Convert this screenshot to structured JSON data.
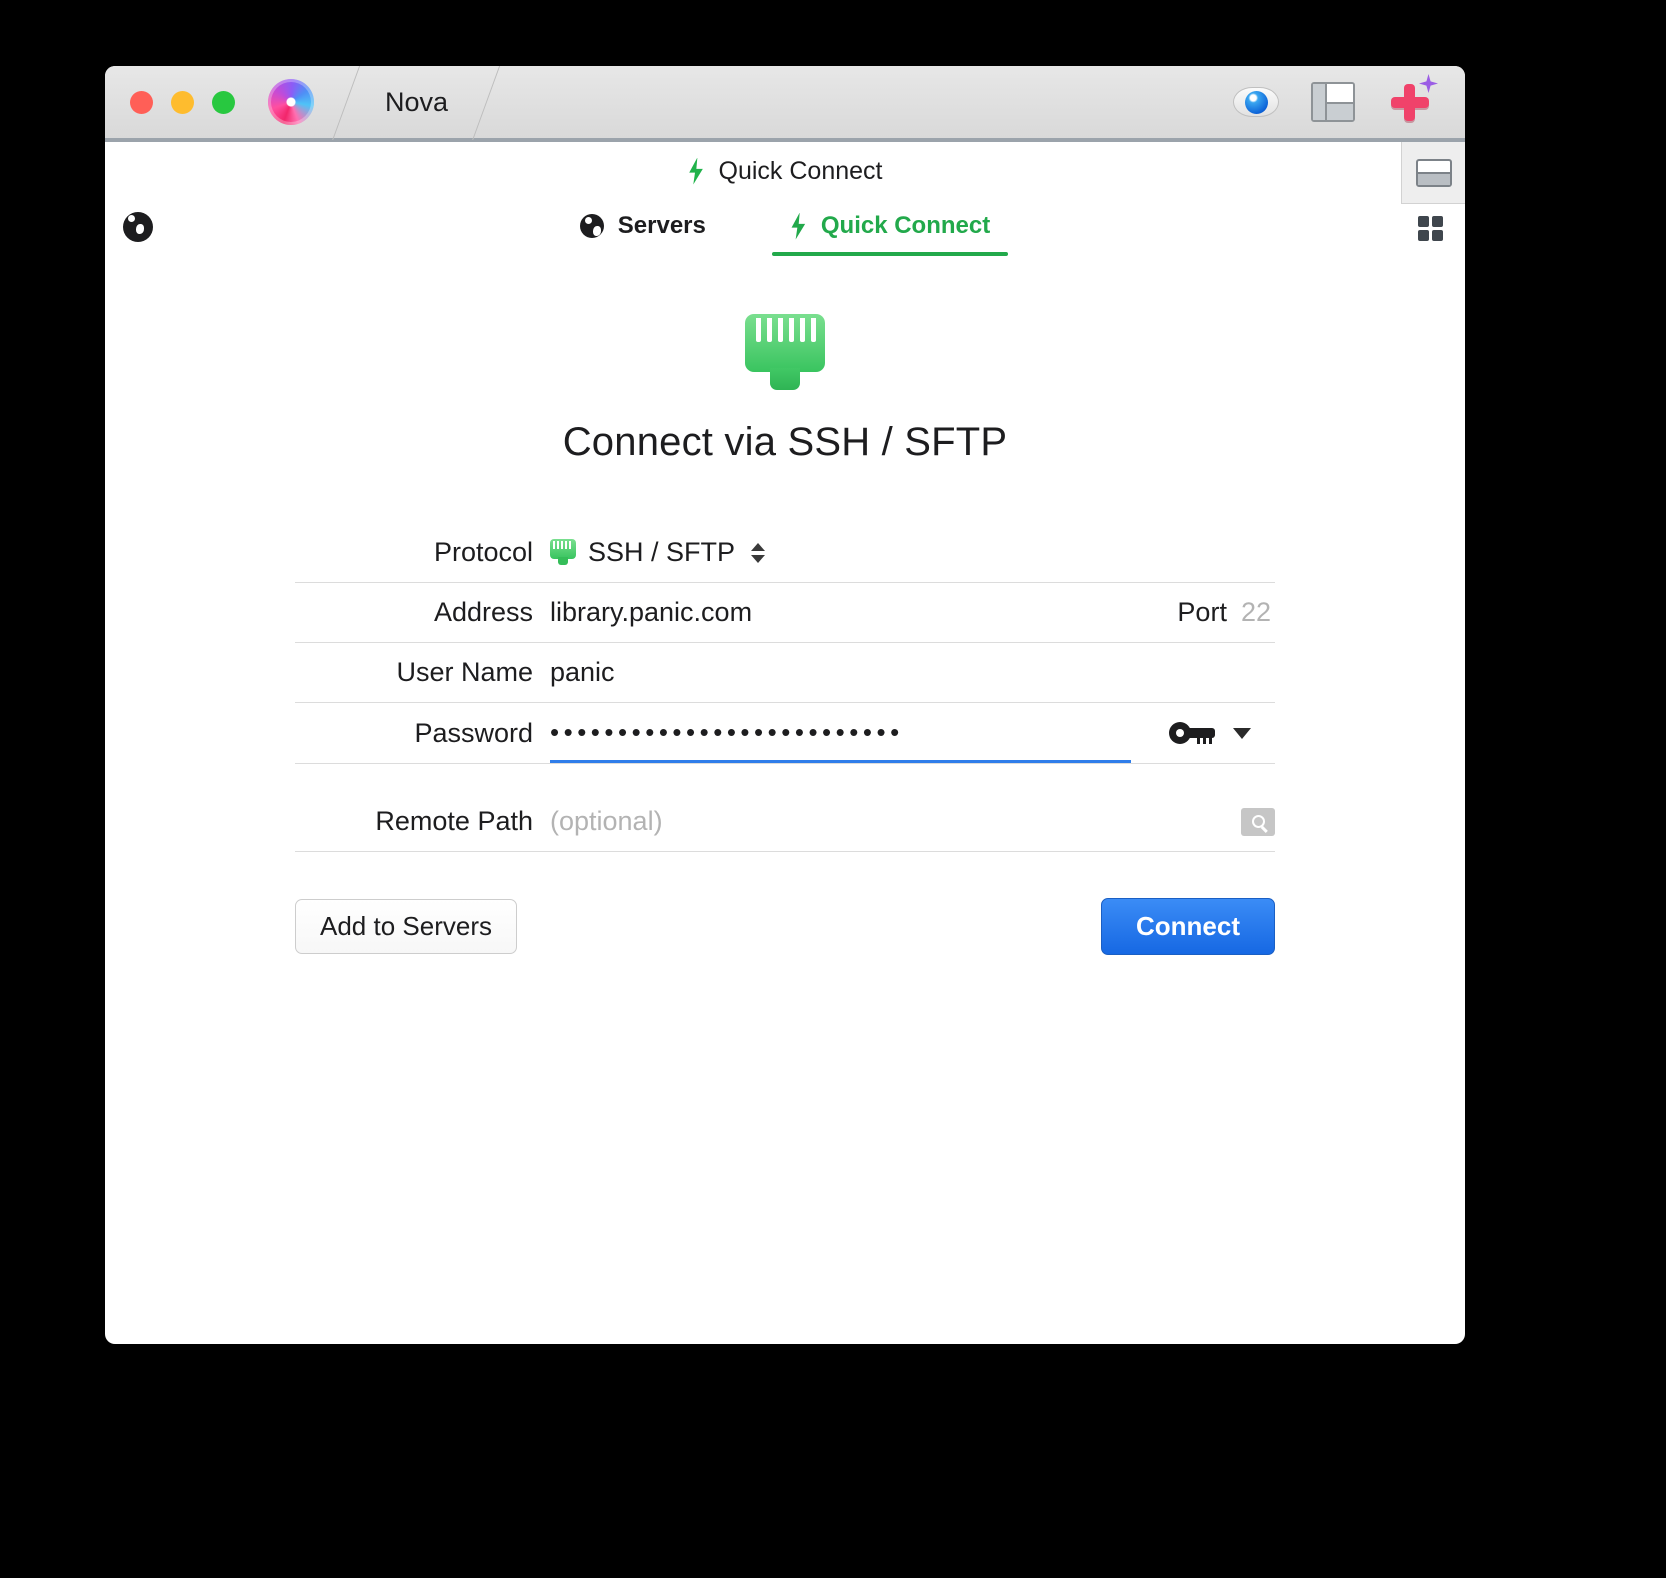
{
  "window": {
    "app_name": "Nova",
    "traffic_lights": [
      "close",
      "minimize",
      "zoom"
    ],
    "toolbar_icons": [
      "eye-icon",
      "layout-panel-icon",
      "plus-sparkle-icon"
    ]
  },
  "subheader": {
    "title": "Quick Connect",
    "icon": "lightning-bolt-icon"
  },
  "tabs": [
    {
      "label": "Servers",
      "icon": "globe-icon",
      "active": false
    },
    {
      "label": "Quick Connect",
      "icon": "lightning-bolt-icon",
      "active": true
    }
  ],
  "main": {
    "hero_icon": "rj45-ethernet-icon",
    "heading": "Connect via SSH / SFTP"
  },
  "form": {
    "protocol": {
      "label": "Protocol",
      "value": "SSH / SFTP",
      "icon": "rj45-ethernet-icon",
      "stepper": "up-down-stepper"
    },
    "address": {
      "label": "Address",
      "value": "library.panic.com"
    },
    "port": {
      "label": "Port",
      "placeholder": "22",
      "value": ""
    },
    "username": {
      "label": "User Name",
      "value": "panic"
    },
    "password": {
      "label": "Password",
      "value": "••••••••••••••••••••••••••",
      "key_icon": "key-icon",
      "chevron": "chevron-down-icon"
    },
    "remote_path": {
      "label": "Remote Path",
      "placeholder": "(optional)",
      "value": "",
      "browse_icon": "browse-magnifier-icon"
    }
  },
  "actions": {
    "secondary_label": "Add to Servers",
    "primary_label": "Connect"
  },
  "colors": {
    "accent_green": "#22a94b",
    "primary_blue": "#2f7dea",
    "focus_underline": "#2f7dea",
    "placeholder_grey": "#b3b3b3"
  }
}
